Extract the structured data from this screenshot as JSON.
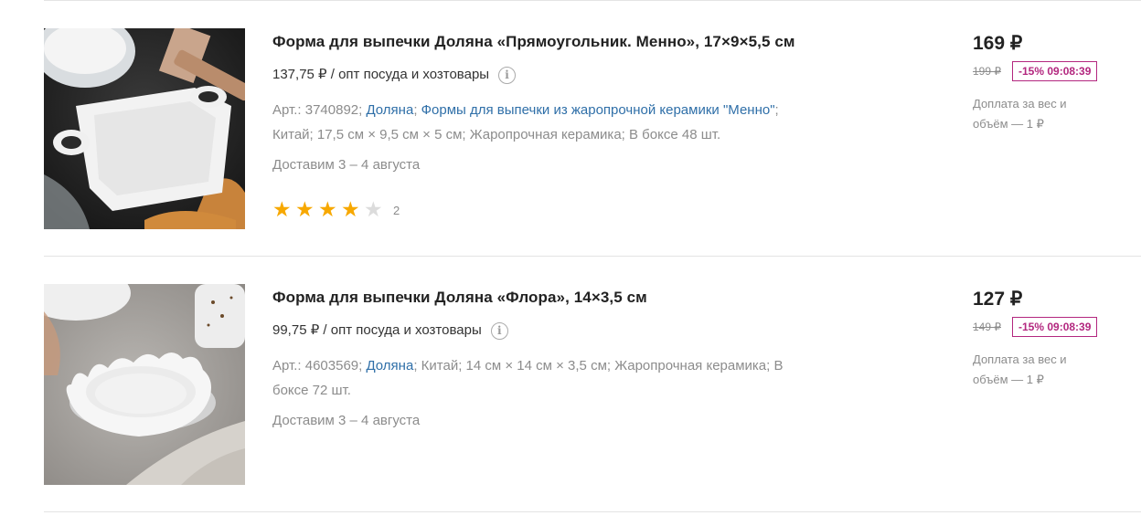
{
  "products": [
    {
      "title": "Форма для выпечки Доляна «Прямоугольник. Менно», 17×9×5,5 см",
      "wholesale": "137,75 ₽ / опт посуда и хозтовары",
      "article": "Арт.: 3740892;",
      "brand": "Доляна",
      "collection": "Формы для выпечки из жаропрочной керамики \"Менно\"",
      "details": "Китай; 17,5 см × 9,5 см × 5 см; Жаропрочная керамика; В боксе 48 шт.",
      "delivery": "Доставим 3 – 4 августа",
      "rating": 4,
      "reviews": "2",
      "price": "169 ₽",
      "old_price": "199 ₽",
      "discount": "-15% 09:08:39",
      "surcharge": "Доплата за вес и объём — 1 ₽"
    },
    {
      "title": "Форма для выпечки Доляна «Флора», 14×3,5 см",
      "wholesale": "99,75 ₽ / опт посуда и хозтовары",
      "article": "Арт.: 4603569;",
      "brand": "Доляна",
      "details": "Китай; 14 см × 14 см × 3,5 см; Жаропрочная керамика; В боксе 72 шт.",
      "delivery": "Доставим 3 – 4 августа",
      "price": "127 ₽",
      "old_price": "149 ₽",
      "discount": "-15% 09:08:39",
      "surcharge": "Доплата за вес и объём — 1 ₽"
    }
  ],
  "icons": {
    "info": "info-icon",
    "star": "star-icon"
  },
  "colors": {
    "link": "#2f6fa8",
    "discount": "#b3277f",
    "star": "#f7a800"
  }
}
